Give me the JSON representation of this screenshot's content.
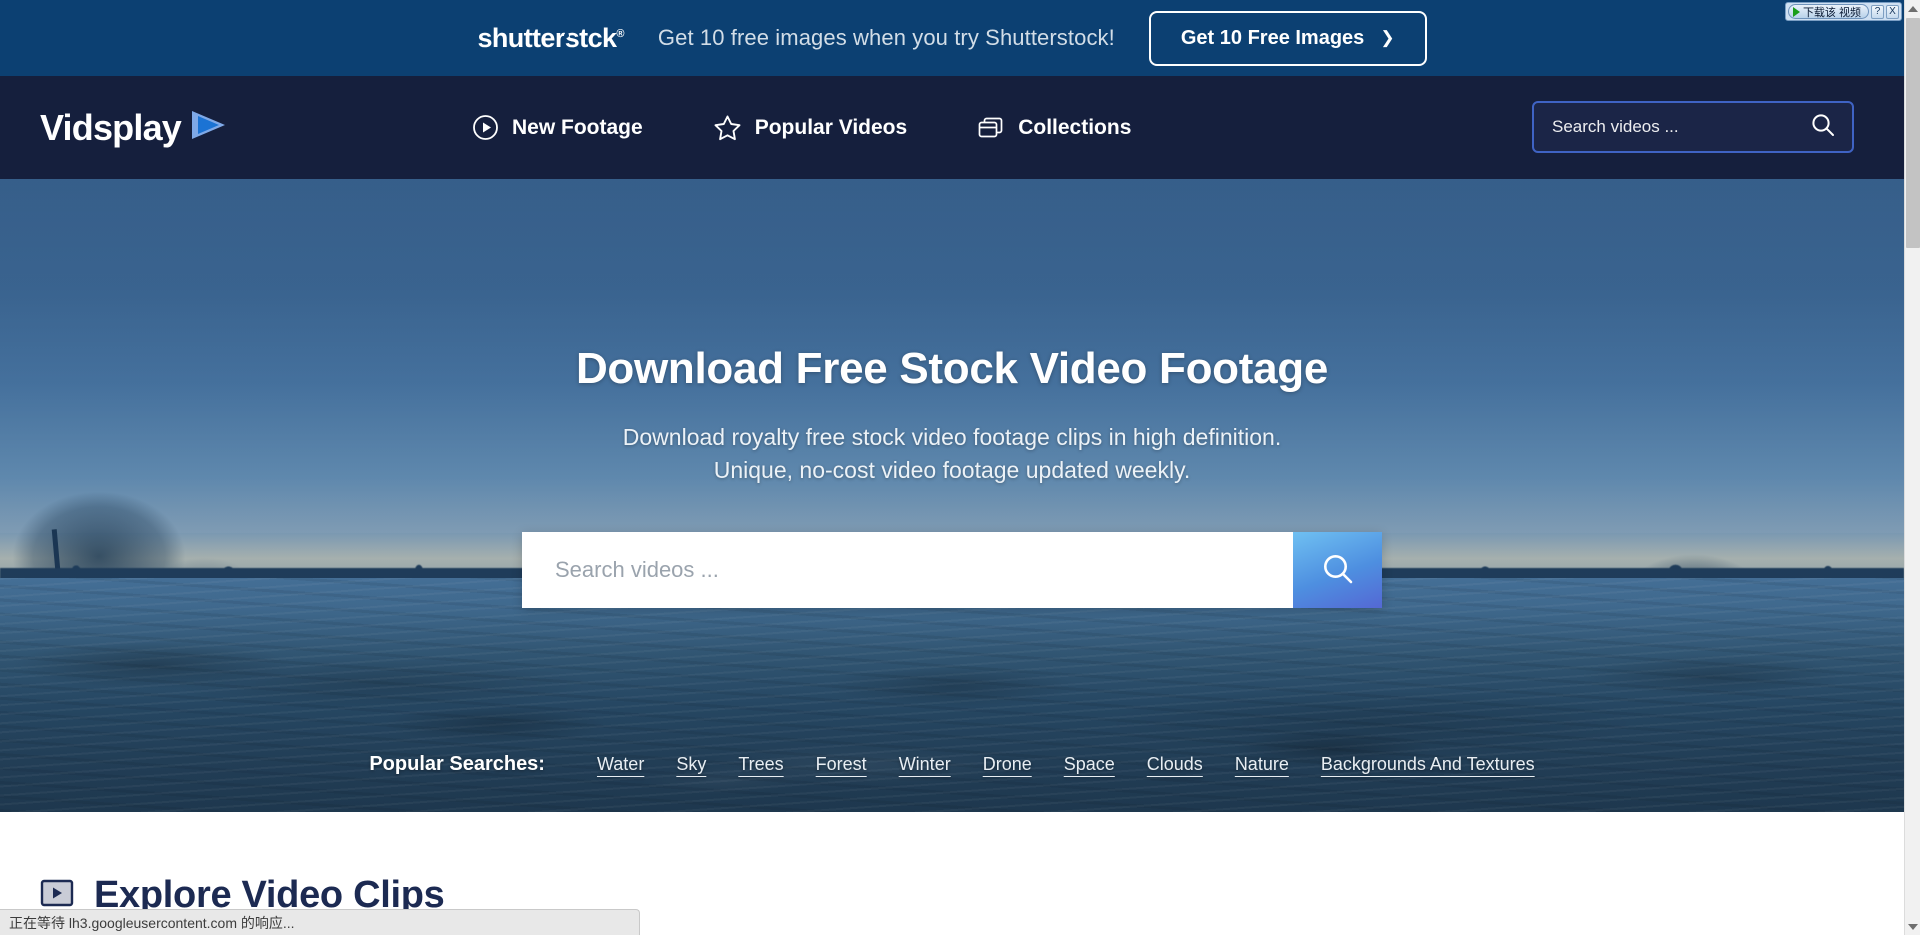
{
  "promo_banner": {
    "brand": "shutterst",
    "brand_tail": "ck",
    "registered": "®",
    "message": "Get 10 free images when you try Shutterstock!",
    "cta_label": "Get 10 Free Images",
    "cta_chevron": "❯",
    "bg_color": "#0c4072"
  },
  "navbar": {
    "brand_name": "Vidsplay",
    "brand_icon": "play-triangle-icon",
    "bg_color": "#151f3d",
    "links": [
      {
        "label": "New Footage",
        "icon": "play-circle-icon"
      },
      {
        "label": "Popular Videos",
        "icon": "star-icon"
      },
      {
        "label": "Collections",
        "icon": "cards-stack-icon"
      }
    ],
    "search": {
      "placeholder": "Search videos ...",
      "value": "",
      "icon": "search-icon",
      "border_color": "#3f63c4"
    }
  },
  "hero": {
    "title": "Download Free Stock Video Footage",
    "subtitle_line1": "Download royalty free stock video footage clips in high definition.",
    "subtitle_line2": "Unique, no-cost video footage updated weekly.",
    "search": {
      "placeholder": "Search videos ...",
      "value": "",
      "button_icon": "search-icon"
    },
    "popular": {
      "label": "Popular Searches:",
      "tags": [
        "Water",
        "Sky",
        "Trees",
        "Forest",
        "Winter",
        "Drone",
        "Space",
        "Clouds",
        "Nature",
        "Backgrounds And Textures"
      ]
    }
  },
  "explore": {
    "title": "Explore Video Clips",
    "icon": "video-play-box-icon"
  },
  "browser": {
    "status_text": "正在等待 lh3.googleusercontent.com 的响应...",
    "scrollbar": {
      "up_icon": "caret-up-icon",
      "down_icon": "caret-down-icon"
    }
  },
  "download_widget": {
    "label": "下载该 视频",
    "play_icon": "play-triangle-icon",
    "help_label": "?",
    "close_label": "X"
  }
}
